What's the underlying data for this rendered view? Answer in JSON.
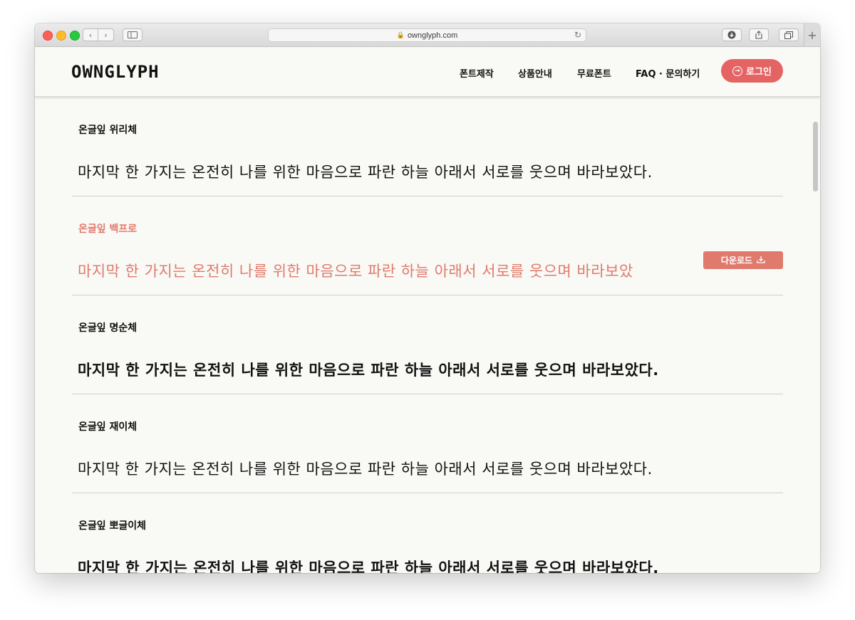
{
  "browser": {
    "url": "ownglyph.com"
  },
  "site": {
    "logo": "OWNGLYPH",
    "nav": [
      "폰트제작",
      "상품안내",
      "무료폰트",
      "FAQ · 문의하기"
    ],
    "login_label": "로그인",
    "accent_color": "#e46464"
  },
  "fonts": [
    {
      "name": "온글잎 위리체",
      "sample": "마지막 한 가지는 온전히 나를 위한 마음으로 파란 하늘 아래서 서로를 웃으며 바라보았다."
    },
    {
      "name": "온글잎 백프로",
      "sample": "마지막 한 가지는 온전히 나를 위한 마음으로 파란 하늘 아래서 서로를 웃으며 바라보았",
      "download_label": "다운로드"
    },
    {
      "name": "온글잎 명순체",
      "sample": "마지막 한 가지는 온전히 나를 위한 마음으로 파란 하늘 아래서 서로를 웃으며 바라보았다."
    },
    {
      "name": "온글잎 재이체",
      "sample": "마지막 한 가지는 온전히 나를 위한 마음으로 파란 하늘 아래서 서로를 웃으며 바라보았다."
    },
    {
      "name": "온글잎 뽀글이체",
      "sample": "마지막 한 가지는 온전히 나를 위한 마음으로 파란 하늘 아래서 서로를 웃으며 바라보았다."
    }
  ]
}
